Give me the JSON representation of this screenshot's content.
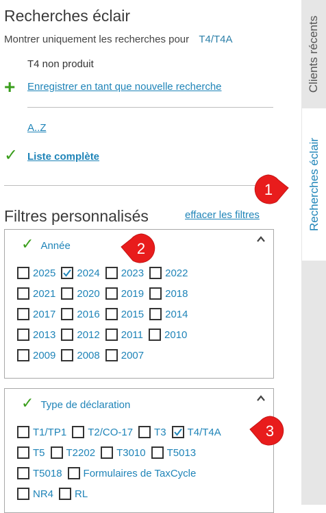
{
  "header": {
    "title": "Recherches éclair",
    "show_for_label": "Montrer uniquement les recherches pour",
    "show_for_value": "T4/T4A"
  },
  "saved_search": "T4 non produit",
  "save_new": "Enregistrer en tant que nouvelle recherche",
  "az": "A..Z",
  "full_list": "Liste complète",
  "custom_filters": {
    "title": "Filtres personnalisés",
    "clear_label": "effacer les filtres"
  },
  "year_filter": {
    "title": "Année",
    "items": [
      {
        "label": "2025",
        "checked": false
      },
      {
        "label": "2024",
        "checked": true
      },
      {
        "label": "2023",
        "checked": false
      },
      {
        "label": "2022",
        "checked": false
      },
      {
        "label": "2021",
        "checked": false
      },
      {
        "label": "2020",
        "checked": false
      },
      {
        "label": "2019",
        "checked": false
      },
      {
        "label": "2018",
        "checked": false
      },
      {
        "label": "2017",
        "checked": false
      },
      {
        "label": "2016",
        "checked": false
      },
      {
        "label": "2015",
        "checked": false
      },
      {
        "label": "2014",
        "checked": false
      },
      {
        "label": "2013",
        "checked": false
      },
      {
        "label": "2012",
        "checked": false
      },
      {
        "label": "2011",
        "checked": false
      },
      {
        "label": "2010",
        "checked": false
      },
      {
        "label": "2009",
        "checked": false
      },
      {
        "label": "2008",
        "checked": false
      },
      {
        "label": "2007",
        "checked": false
      }
    ]
  },
  "type_filter": {
    "title": "Type de déclaration",
    "items": [
      {
        "label": "T1/TP1",
        "checked": false
      },
      {
        "label": "T2/CO-17",
        "checked": false
      },
      {
        "label": "T3",
        "checked": false
      },
      {
        "label": "T4/T4A",
        "checked": true
      },
      {
        "label": "T5",
        "checked": false
      },
      {
        "label": "T2202",
        "checked": false
      },
      {
        "label": "T3010",
        "checked": false
      },
      {
        "label": "T5013",
        "checked": false
      },
      {
        "label": "T5018",
        "checked": false
      },
      {
        "label": "Formulaires de TaxCycle",
        "checked": false
      },
      {
        "label": "NR4",
        "checked": false
      },
      {
        "label": "RL",
        "checked": false
      }
    ]
  },
  "sidebar": {
    "tabs": [
      "Clients récents",
      "Recherches éclair"
    ]
  },
  "callouts": [
    "1",
    "2",
    "3"
  ],
  "colors": {
    "accent": "#1f84b8",
    "check_green": "#3a9e1c",
    "callout_red": "#e81c1c"
  }
}
